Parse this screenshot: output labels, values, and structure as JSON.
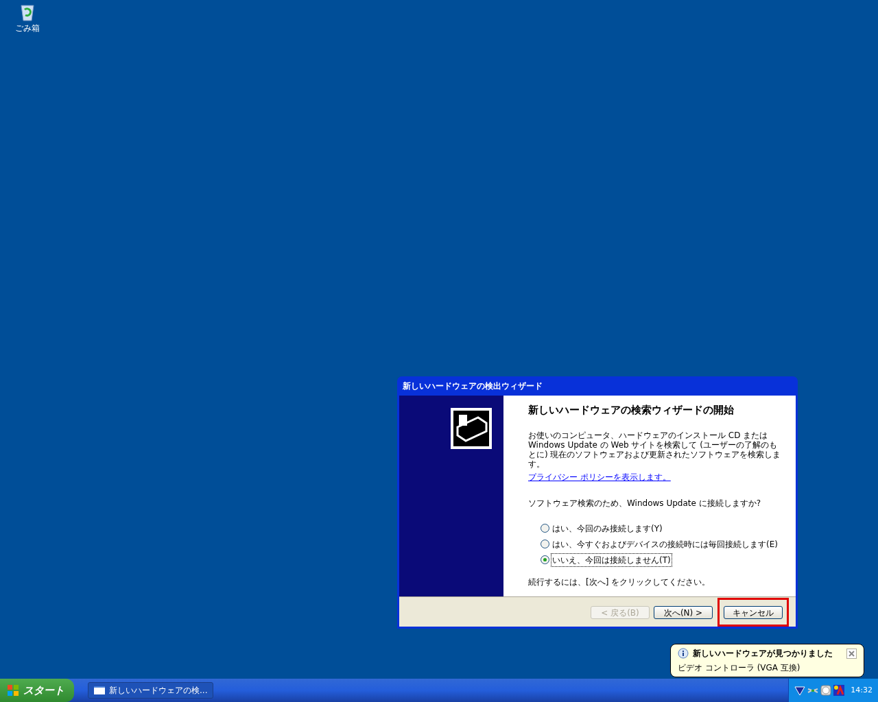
{
  "desktop_icons": [
    {
      "label": "ごみ箱"
    }
  ],
  "wizard": {
    "title": "新しいハードウェアの検出ウィザード",
    "heading": "新しいハードウェアの検索ウィザードの開始",
    "intro": "お使いのコンピュータ、ハードウェアのインストール CD または Windows Update の Web サイトを検索して (ユーザーの了解のもとに) 現在のソフトウェアおよび更新されたソフトウェアを検索します。",
    "privacy_link": "プライバシー ポリシーを表示します。",
    "question": "ソフトウェア検索のため、Windows Update に接続しますか?",
    "options": [
      {
        "label": "はい、今回のみ接続します(Y)",
        "selected": false
      },
      {
        "label": "はい、今すぐおよびデバイスの接続時には毎回接続します(E)",
        "selected": false
      },
      {
        "label": "いいえ、今回は接続しません(T)",
        "selected": true
      }
    ],
    "footer_hint": "続行するには、[次へ] をクリックしてください。",
    "buttons": [
      {
        "label": "< 戻る(B)",
        "disabled": true,
        "highlighted": false
      },
      {
        "label": "次へ(N) >",
        "disabled": false,
        "highlighted": false
      },
      {
        "label": "キャンセル",
        "disabled": false,
        "highlighted": true
      }
    ]
  },
  "balloon": {
    "title": "新しいハードウェアが見つかりました",
    "text": "ビデオ コントローラ (VGA 互換)"
  },
  "taskbar": {
    "start": "スタート",
    "tasks": [
      {
        "label": "新しいハードウェアの検..."
      }
    ],
    "clock": "14:32"
  }
}
